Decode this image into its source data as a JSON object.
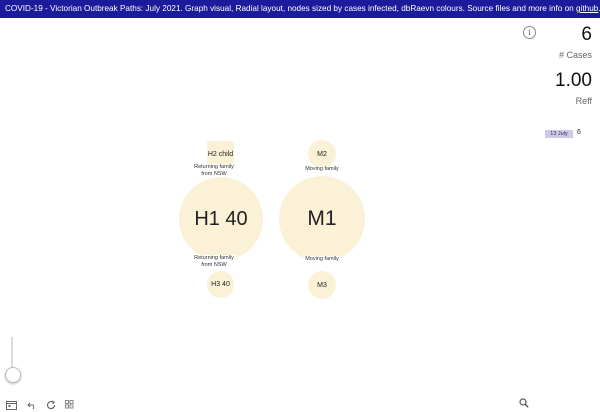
{
  "header": {
    "title": "COVID-19  - Victorian Outbreak Paths: July 2021.  Graph visual, Radial layout, nodes sized by cases infected, dbRaevn colours. Source files and more info on ",
    "link_text": "github",
    "title_end": "."
  },
  "stats": {
    "info_icon": "i",
    "cases_value": "6",
    "cases_label": "# Cases",
    "reff_value": "1.00",
    "reff_label": "Reff"
  },
  "timeline": {
    "date_label": "13 July",
    "count": "6"
  },
  "graph": {
    "nodes": {
      "h2": "H2 child",
      "h1": "H1 40",
      "h3": "H3 40",
      "m2": "M2",
      "m1": "M1",
      "m3": "M3"
    },
    "edge_labels": {
      "h1_h2": "Returning family from NSW",
      "h1_h3": "Returning family from NSW",
      "m1_m2": "Moving family",
      "m1_m3": "Moving family"
    },
    "node_color": "#fbf1d6"
  },
  "toolbar": {
    "icons": [
      "calendar-icon",
      "undo-icon",
      "refresh-icon",
      "grid-icon",
      "search-icon"
    ]
  }
}
